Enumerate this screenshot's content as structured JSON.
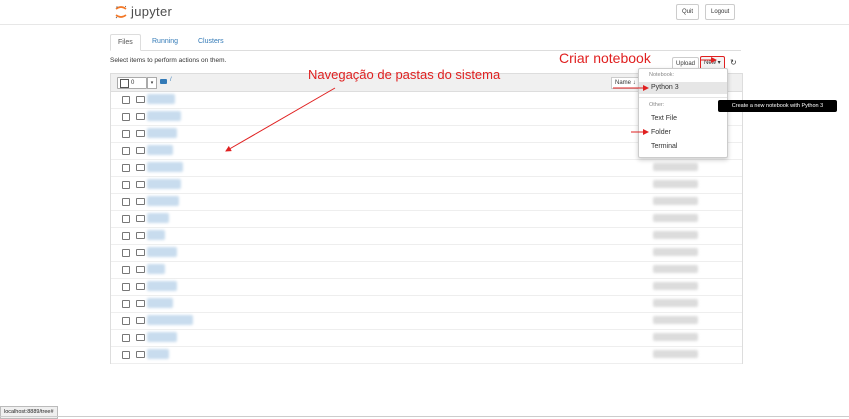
{
  "header": {
    "logo_text": "jupyter",
    "quit_label": "Quit",
    "logout_label": "Logout"
  },
  "tabs": [
    {
      "label": "Files",
      "active": true
    },
    {
      "label": "Running",
      "active": false
    },
    {
      "label": "Clusters",
      "active": false
    }
  ],
  "toolbar": {
    "select_msg": "Select items to perform actions on them.",
    "upload_label": "Upload",
    "new_label": "New ▾"
  },
  "list_header": {
    "selected_count": "0",
    "path": "/",
    "name_sort_label": "Name ↓"
  },
  "new_menu": {
    "notebook_header": "Notebook:",
    "python3": "Python 3",
    "other_header": "Other:",
    "text_file": "Text File",
    "folder": "Folder",
    "terminal": "Terminal",
    "tooltip": "Create a new notebook with Python 3"
  },
  "annotations": {
    "criar": "Criar notebook",
    "navegacao": "Navegação de pastas do sistema"
  },
  "status_bar": "localhost:8889/tree#",
  "colors": {
    "annotation_red": "#e02020",
    "link_blue": "#337ab7",
    "logo_orange": "#f37726"
  }
}
